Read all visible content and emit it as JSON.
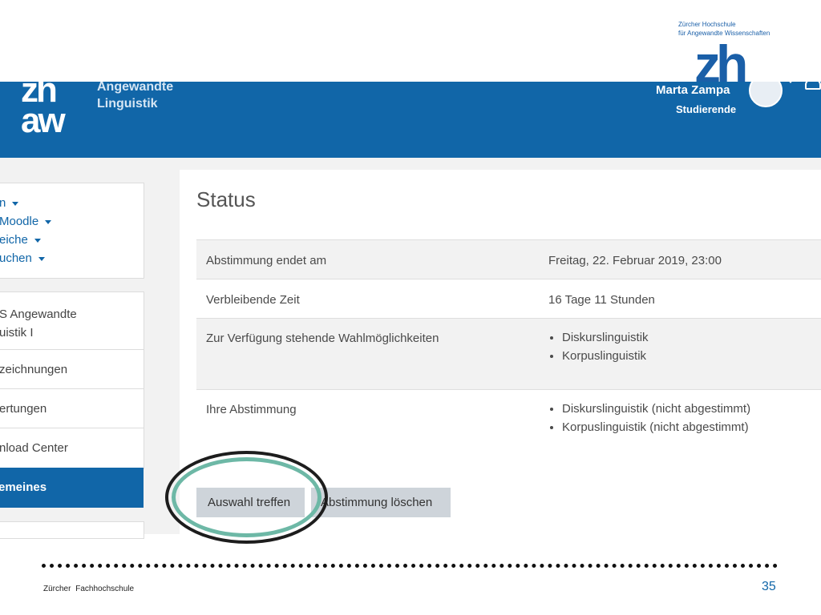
{
  "slide": {
    "logo_line1": "Zürcher Hochschule",
    "logo_line2": "für Angewandte Wissenschaften",
    "logo_mark": "zh",
    "footer": "Zürcher Fachhochschule",
    "page_number": "35"
  },
  "header": {
    "logo_top": "zh",
    "logo_bottom": "aw",
    "site_line1": "Angewandte",
    "site_line2": "Linguistik",
    "user_name": "Marta Zampa",
    "user_role": "Studierende"
  },
  "sidebar": {
    "menu_links": [
      {
        "label": "n"
      },
      {
        "label": "Moodle"
      },
      {
        "label": "eiche"
      },
      {
        "label": "uchen"
      }
    ],
    "nav_items": [
      {
        "label": "S Angewandte"
      },
      {
        "label": "uistik I"
      },
      {
        "label": "zeichnungen"
      },
      {
        "label": "ertungen"
      },
      {
        "label": "nload Center"
      }
    ],
    "active_item": "emeines"
  },
  "main": {
    "title": "Status",
    "rows": [
      {
        "label": "Abstimmung endet am",
        "value": "Freitag, 22. Februar 2019, 23:00"
      },
      {
        "label": "Verbleibende Zeit",
        "value": "16 Tage 11 Stunden"
      },
      {
        "label": "Zur Verfügung stehende Wahlmöglichkeiten",
        "options": [
          "Diskurslinguistik",
          "Korpuslinguistik"
        ]
      },
      {
        "label": "Ihre Abstimmung",
        "options": [
          "Diskurslinguistik (nicht abgestimmt)",
          "Korpuslinguistik (nicht abgestimmt)"
        ]
      }
    ],
    "button_select": "Auswahl treffen",
    "button_delete": "Abstimmung löschen"
  },
  "colors": {
    "brand_blue": "#1166a8",
    "highlight_green": "#6db8a6",
    "button_gray": "#ced4da"
  }
}
